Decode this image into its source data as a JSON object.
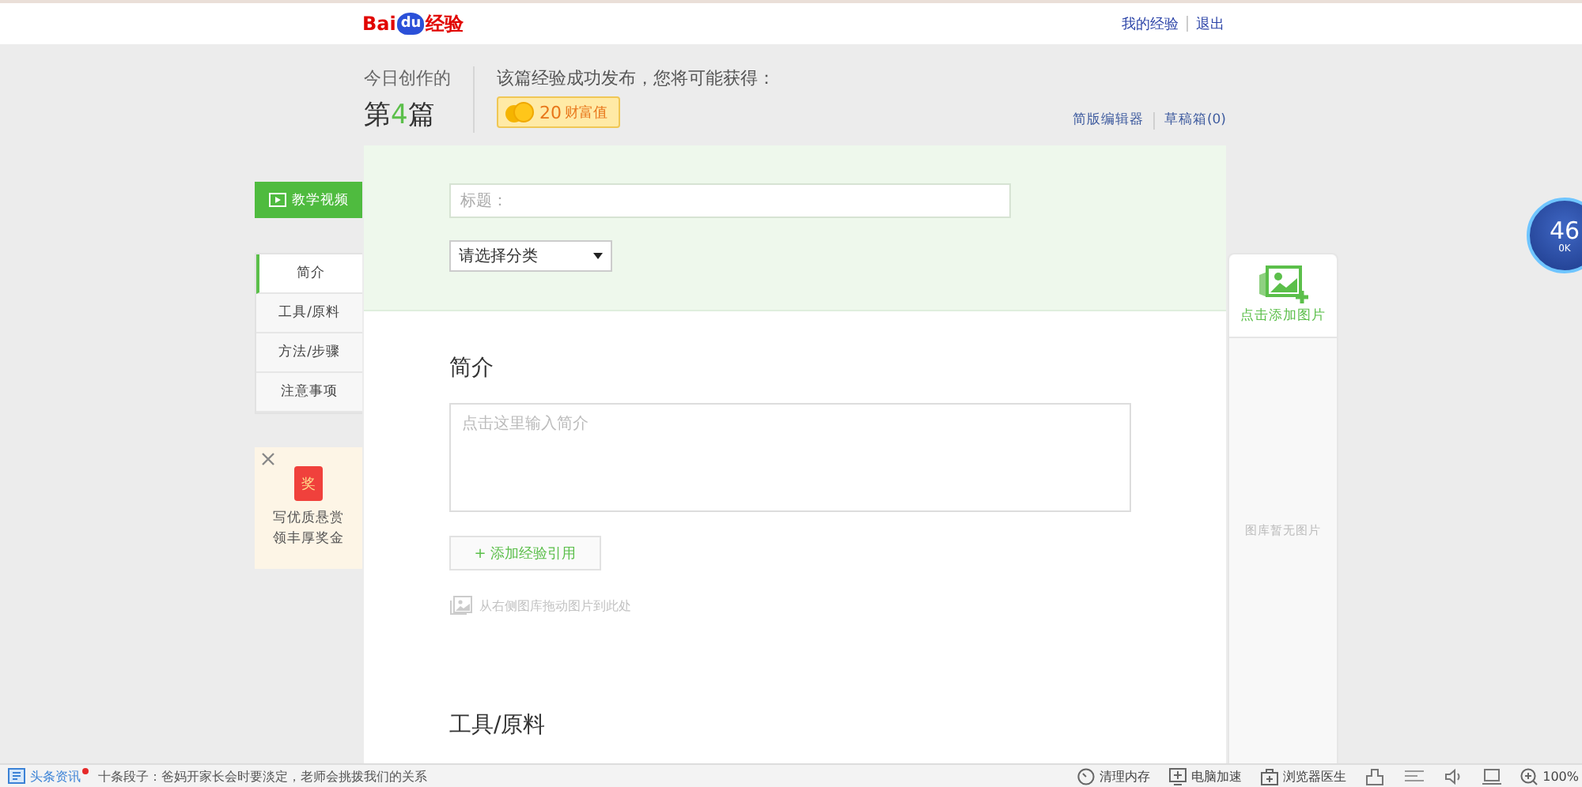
{
  "top_bar": {
    "logo": {
      "brand": "Bai",
      "badge": "du",
      "suffix": "经验"
    },
    "links": [
      "我的经验",
      "退出"
    ]
  },
  "header": {
    "today_label": "今日创作的",
    "count_prefix": "第",
    "count": "4",
    "count_suffix": "篇",
    "reward_intro": "该篇经验成功发布，您将可能获得：",
    "reward_amount": "20",
    "reward_unit": "财富值",
    "editor_links": [
      "简版编辑器",
      "草稿箱(0)"
    ]
  },
  "sidebar": {
    "video_button": "教学视频",
    "items": [
      {
        "label": "简介",
        "selected": true
      },
      {
        "label": "工具/原料",
        "selected": false
      },
      {
        "label": "方法/步骤",
        "selected": false
      },
      {
        "label": "注意事项",
        "selected": false
      }
    ],
    "promo": {
      "gift_label": "奖",
      "lines": [
        "写优质悬赏",
        "领丰厚奖金"
      ]
    }
  },
  "form": {
    "title_placeholder": "标题：",
    "category": "请选择分类",
    "intro_heading": "简介",
    "intro_placeholder": "点击这里输入简介",
    "add_reference": "+ 添加经验引用",
    "drag_hint": "从右侧图库拖动图片到此处",
    "tools_heading": "工具/原料"
  },
  "gallery": {
    "add_label": "点击添加图片",
    "empty_text": "图库暂无图片"
  },
  "speed_widget": {
    "percent": "46",
    "rate": "0K"
  },
  "status_bar": {
    "news_label": "头条资讯",
    "has_notice": true,
    "headline": "十条段子：爸妈开家长会时要淡定，老师会挑拨我们的关系",
    "tools": [
      {
        "kind": "clean",
        "label": "清理内存"
      },
      {
        "kind": "speed",
        "label": "电脑加速"
      },
      {
        "kind": "doctor",
        "label": "浏览器医生"
      }
    ],
    "zoom": "100%"
  }
}
